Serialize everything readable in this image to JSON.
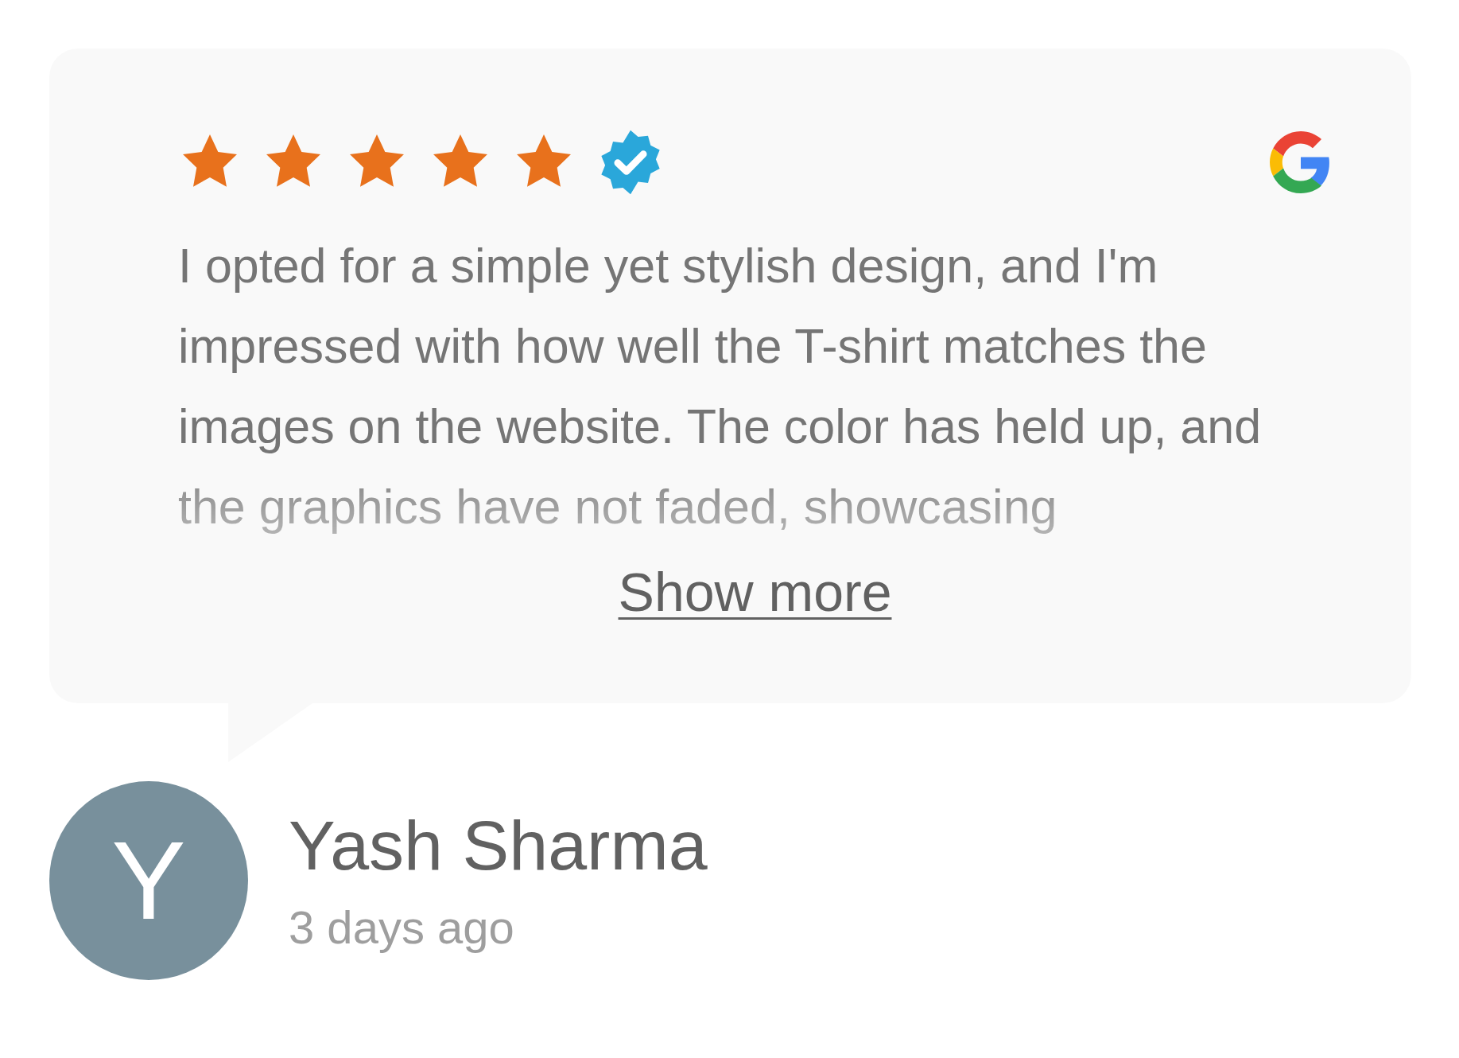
{
  "review": {
    "stars": 5,
    "verified": true,
    "text": "I opted for a simple yet stylish design, and I'm impressed with how well the T-shirt matches the images on the website. The color has held up, and the graphics have not faded, showcasing",
    "show_more": "Show more"
  },
  "author": {
    "initial": "Y",
    "name": "Yash Sharma",
    "time": "3 days ago"
  }
}
